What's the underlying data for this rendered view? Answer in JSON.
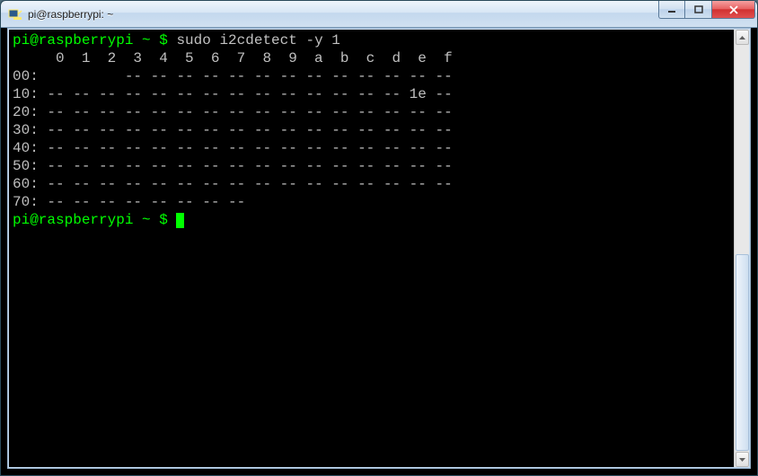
{
  "window": {
    "title": "pi@raspberrypi: ~"
  },
  "terminal": {
    "prompt_user_host": "pi@raspberrypi",
    "prompt_sep": " ~ $ ",
    "command": "sudo i2cdetect -y 1",
    "header": "     0  1  2  3  4  5  6  7  8  9  a  b  c  d  e  f",
    "rows": [
      {
        "addr": "00:",
        "cells": "          -- -- -- -- -- -- -- -- -- -- -- -- --"
      },
      {
        "addr": "10:",
        "cells": " -- -- -- -- -- -- -- -- -- -- -- -- -- -- 1e --"
      },
      {
        "addr": "20:",
        "cells": " -- -- -- -- -- -- -- -- -- -- -- -- -- -- -- --"
      },
      {
        "addr": "30:",
        "cells": " -- -- -- -- -- -- -- -- -- -- -- -- -- -- -- --"
      },
      {
        "addr": "40:",
        "cells": " -- -- -- -- -- -- -- -- -- -- -- -- -- -- -- --"
      },
      {
        "addr": "50:",
        "cells": " -- -- -- -- -- -- -- -- -- -- -- -- -- -- -- --"
      },
      {
        "addr": "60:",
        "cells": " -- -- -- -- -- -- -- -- -- -- -- -- -- -- -- --"
      },
      {
        "addr": "70:",
        "cells": " -- -- -- -- -- -- -- --"
      }
    ]
  }
}
